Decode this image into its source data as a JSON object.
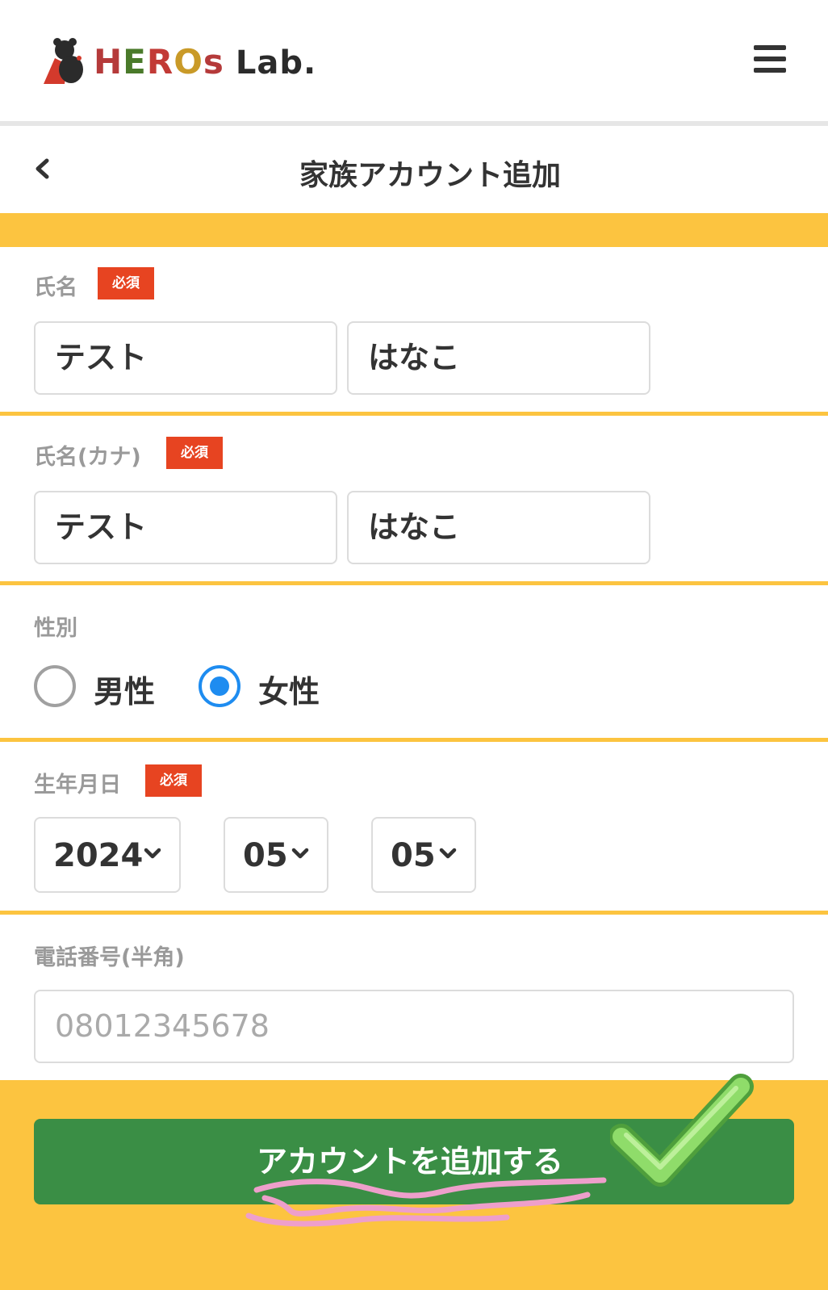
{
  "brand": {
    "name_letters": [
      "H",
      "E",
      "R",
      "O",
      "s"
    ],
    "name_suffix": "Lab.",
    "letter_colors": [
      "#b53a3a",
      "#4a7a2a",
      "#c23a36",
      "#c99a28",
      "#b53a3a"
    ]
  },
  "header": {
    "menu_icon": "hamburger-menu-icon"
  },
  "page": {
    "title": "家族アカウント追加",
    "back_icon": "chevron-left-icon"
  },
  "form": {
    "name": {
      "label": "氏名",
      "required_badge": "必須",
      "last_name": "テスト",
      "first_name": "はなこ"
    },
    "name_kana": {
      "label": "氏名(カナ)",
      "required_badge": "必須",
      "last_name": "テスト",
      "first_name": "はなこ"
    },
    "gender": {
      "label": "性別",
      "options": [
        "男性",
        "女性"
      ],
      "selected": "女性"
    },
    "birthdate": {
      "label": "生年月日",
      "required_badge": "必須",
      "year": "2024",
      "month": "05",
      "day": "05"
    },
    "phone": {
      "label": "電話番号(半角)",
      "placeholder": "08012345678"
    }
  },
  "submit": {
    "label": "アカウントを追加する"
  },
  "colors": {
    "accent_yellow": "#fcc440",
    "required_red": "#e74421",
    "button_green": "#3a8e45",
    "radio_blue": "#1e8cf0",
    "annotation_pink": "#ee9fcb",
    "annotation_check": "#8fdc6a"
  }
}
